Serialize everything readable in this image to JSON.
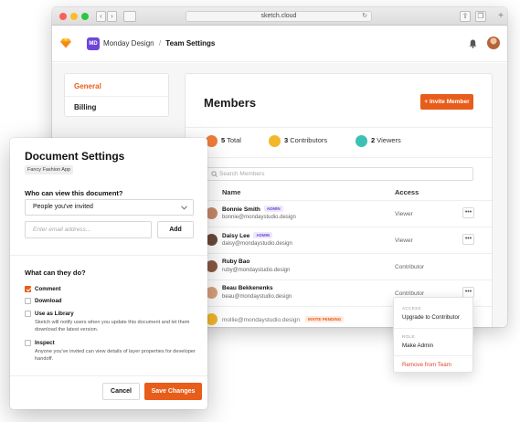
{
  "browser": {
    "url": "sketch.cloud",
    "nav_back": "‹",
    "nav_forward": "›"
  },
  "header": {
    "workspace_initials": "MD",
    "workspace_name": "Monday Design",
    "separator": "/",
    "page": "Team Settings",
    "icons": [
      "sketch-logo-icon",
      "bell-icon",
      "user-avatar"
    ]
  },
  "sidebar": {
    "items": [
      {
        "label": "General",
        "active": true
      },
      {
        "label": "Billing",
        "active": false
      }
    ]
  },
  "members": {
    "title": "Members",
    "invite_label": "+ Invite Member",
    "stats": [
      {
        "count": "5",
        "label": "Total",
        "color": "#f07c3b"
      },
      {
        "count": "3",
        "label": "Contributors",
        "color": "#f2b82b"
      },
      {
        "count": "2",
        "label": "Viewers",
        "color": "#3cc1b4"
      }
    ],
    "search_placeholder": "Search Members",
    "columns": {
      "name": "Name",
      "access": "Access"
    },
    "rows": [
      {
        "name": "Bonnie Smith",
        "badge": "ADMIN",
        "email": "bonnie@mondaystudio.design",
        "access": "Viewer",
        "avatar": "#c98a6a"
      },
      {
        "name": "Daisy Lee",
        "badge": "ADMIN",
        "email": "daisy@mondaystudio.design",
        "access": "Viewer",
        "avatar": "#6b4a3a"
      },
      {
        "name": "Ruby Bao",
        "badge": "",
        "email": "ruby@mondaystudio.design",
        "access": "Contributor",
        "avatar": "#8b5a44"
      },
      {
        "name": "Beau Bekkenenks",
        "badge": "",
        "email": "beau@mondaystudio.design",
        "access": "Contributor",
        "avatar": "#d9a27c"
      }
    ],
    "pending": {
      "email": "mollie@mondaystudio.design",
      "badge": "INVITE PENDING",
      "avatar": "#f2b82b"
    },
    "more_label": "•••"
  },
  "menu": {
    "access_heading": "ACCESS",
    "upgrade_label": "Upgrade to Contributor",
    "role_heading": "ROLE",
    "make_admin_label": "Make Admin",
    "remove_label": "Remove from Team"
  },
  "doc_settings": {
    "title": "Document Settings",
    "project_tag": "Fancy Fashion App",
    "who_label": "Who can view this document?",
    "who_value": "People you've invited",
    "email_placeholder": "Enter email address...",
    "add_label": "Add",
    "what_label": "What can they do?",
    "options": [
      {
        "label": "Comment",
        "checked": true,
        "desc": ""
      },
      {
        "label": "Download",
        "checked": false,
        "desc": ""
      },
      {
        "label": "Use as Library",
        "checked": false,
        "desc": "Sketch will notify users when you update this document and let them download the latest version."
      },
      {
        "label": "Inspect",
        "checked": false,
        "desc": "Anyone you've invited can view details of layer properties for developer handoff."
      }
    ],
    "cancel_label": "Cancel",
    "save_label": "Save Changes"
  },
  "colors": {
    "accent": "#e85d1a",
    "admin_badge": "#6d46d8",
    "danger": "#e0452c"
  }
}
